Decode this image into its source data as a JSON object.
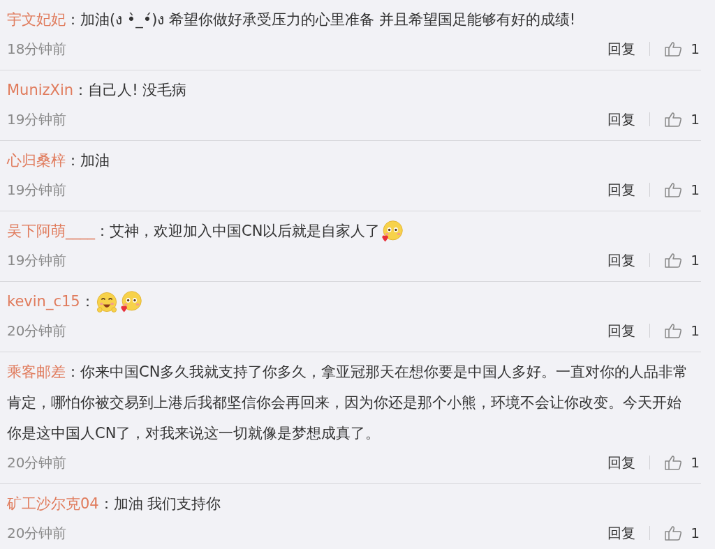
{
  "comments": [
    {
      "user": "宇文妃妃",
      "separator": "：",
      "content": [
        {
          "kind": "text",
          "text": "加油(ง •̀_•́)ง 希望你做好承受压力的心里准备 并且希望国足能够有好的成绩!"
        }
      ],
      "time": "18分钟前",
      "reply": "回复",
      "likes": "1"
    },
    {
      "user": "MunizXin",
      "separator": "：",
      "content": [
        {
          "kind": "text",
          "text": "自己人!  没毛病"
        }
      ],
      "time": "19分钟前",
      "reply": "回复",
      "likes": "1"
    },
    {
      "user": "心归桑梓",
      "separator": "：",
      "content": [
        {
          "kind": "text",
          "text": "加油"
        }
      ],
      "time": "19分钟前",
      "reply": "回复",
      "likes": "1"
    },
    {
      "user": "吴下阿萌____",
      "separator": "：",
      "content": [
        {
          "kind": "text",
          "text": "艾神，欢迎加入中国CN以后就是自家人了"
        },
        {
          "kind": "blush"
        }
      ],
      "time": "19分钟前",
      "reply": "回复",
      "likes": "1"
    },
    {
      "user": "kevin_c15",
      "separator": "：",
      "content": [
        {
          "kind": "grin"
        },
        {
          "kind": "blush"
        }
      ],
      "time": "20分钟前",
      "reply": "回复",
      "likes": "1"
    },
    {
      "user": "乘客邮差",
      "separator": "：",
      "content": [
        {
          "kind": "text",
          "text": "你来中国CN多久我就支持了你多久，拿亚冠那天在想你要是中国人多好。一直对你的人品非常肯定，哪怕你被交易到上港后我都坚信你会再回来，因为你还是那个小熊，环境不会让你改变。今天开始你是这中国人CN了，对我来说这一切就像是梦想成真了。"
        }
      ],
      "time": "20分钟前",
      "reply": "回复",
      "likes": "1"
    },
    {
      "user": "矿工沙尔克04",
      "separator": "：",
      "content": [
        {
          "kind": "text",
          "text": "加油 我们支持你"
        }
      ],
      "time": "20分钟前",
      "reply": "回复",
      "likes": "1"
    }
  ]
}
